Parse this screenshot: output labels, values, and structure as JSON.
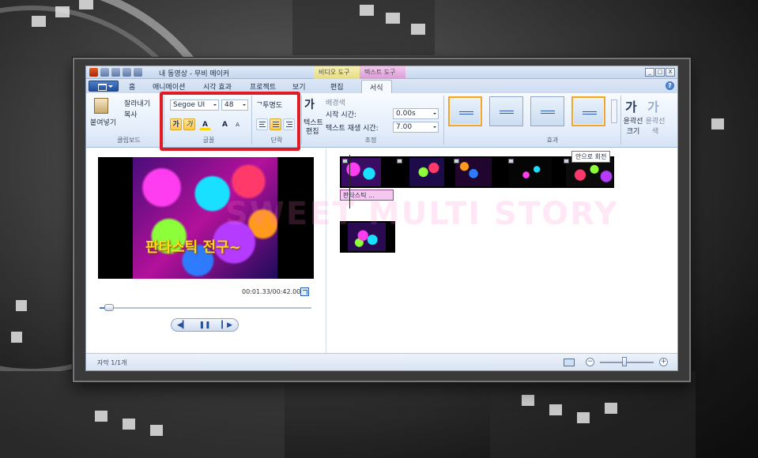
{
  "window": {
    "title": "내 동영상 - 무비 메이커",
    "context_tabs": [
      "비디오 도구",
      "텍스트 도구"
    ],
    "controls": [
      "_",
      "□",
      "X"
    ]
  },
  "tabs": [
    "홈",
    "애니메이션",
    "시각 효과",
    "프로젝트",
    "보기",
    "편집",
    "서식"
  ],
  "active_tab": "서식",
  "ribbon": {
    "clipboard": {
      "paste": "붙여넣기",
      "cut": "잘라내기",
      "copy": "복사",
      "label": "클립보드"
    },
    "font": {
      "family": "Segoe UI",
      "size": "48",
      "bold": "가",
      "italic": "가",
      "color": "A",
      "grow": "A",
      "shrink": "A",
      "label": "글꼴"
    },
    "paragraph": {
      "transparency": "투명도",
      "label": "단락"
    },
    "edit_text": {
      "line1": "텍스트",
      "line2": "편집"
    },
    "adjust": {
      "bg_color": "배경색",
      "start_time_label": "시작 시간:",
      "start_time_value": "0.00s",
      "duration_label": "텍스트 재생 시간:",
      "duration_value": "7.00",
      "label": "조정"
    },
    "effects": {
      "label": "효과",
      "outline_size": "윤곽선 크기",
      "outline_color": "윤곽선 색"
    }
  },
  "tooltip": "안으로 회전",
  "preview": {
    "caption": "판타스틱 전구~",
    "time": "00:01.33/00:42.00",
    "progress": 0.03
  },
  "storyboard": {
    "caption_label": "판타스틱 ..."
  },
  "status": {
    "text": "자막 1/1개",
    "zoom": 0.45
  },
  "watermark": "SWEET MULTI STORY"
}
